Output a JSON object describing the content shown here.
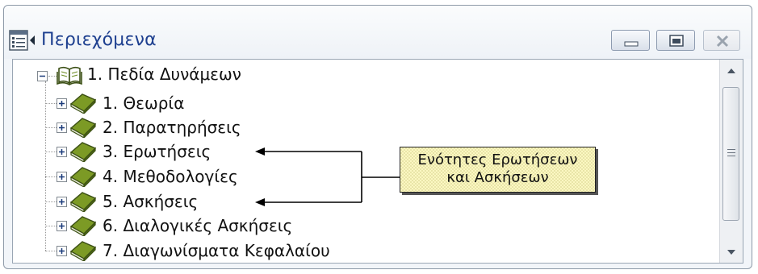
{
  "window": {
    "title": "Περιεχόμενα",
    "icons": {
      "app": "table-of-contents-icon",
      "minimize": "minimize-icon",
      "maximize": "maximize-icon",
      "close": "close-icon"
    }
  },
  "tree": {
    "root": {
      "label": "1. Πεδία Δυνάμεων",
      "expander": "minus",
      "icon": "open-book-icon"
    },
    "children": [
      {
        "label": "1. Θεωρία",
        "expander": "plus",
        "icon": "book-icon"
      },
      {
        "label": "2. Παρατηρήσεις",
        "expander": "plus",
        "icon": "book-icon"
      },
      {
        "label": "3. Ερωτήσεις",
        "expander": "plus",
        "icon": "book-icon"
      },
      {
        "label": "4. Μεθοδολογίες",
        "expander": "plus",
        "icon": "book-icon"
      },
      {
        "label": "5. Ασκήσεις",
        "expander": "plus",
        "icon": "book-icon"
      },
      {
        "label": "6. Διαλογικές Ασκήσεις",
        "expander": "plus",
        "icon": "book-icon"
      },
      {
        "label": "7. Διαγωνίσματα Κεφαλαίου",
        "expander": "plus",
        "icon": "book-icon"
      }
    ]
  },
  "callout": {
    "line1": "Ενότητες Ερωτήσεων",
    "line2": "και Ασκήσεων",
    "points_to": [
      "3. Ερωτήσεις",
      "5. Ασκήσεις"
    ]
  },
  "scrollbar": {
    "up": "scroll-up-arrow-icon",
    "down": "scroll-down-arrow-icon"
  },
  "colors": {
    "title": "#1d3f8f",
    "callout_bg": "#fbf7c2",
    "book": "#6b8a1f"
  }
}
